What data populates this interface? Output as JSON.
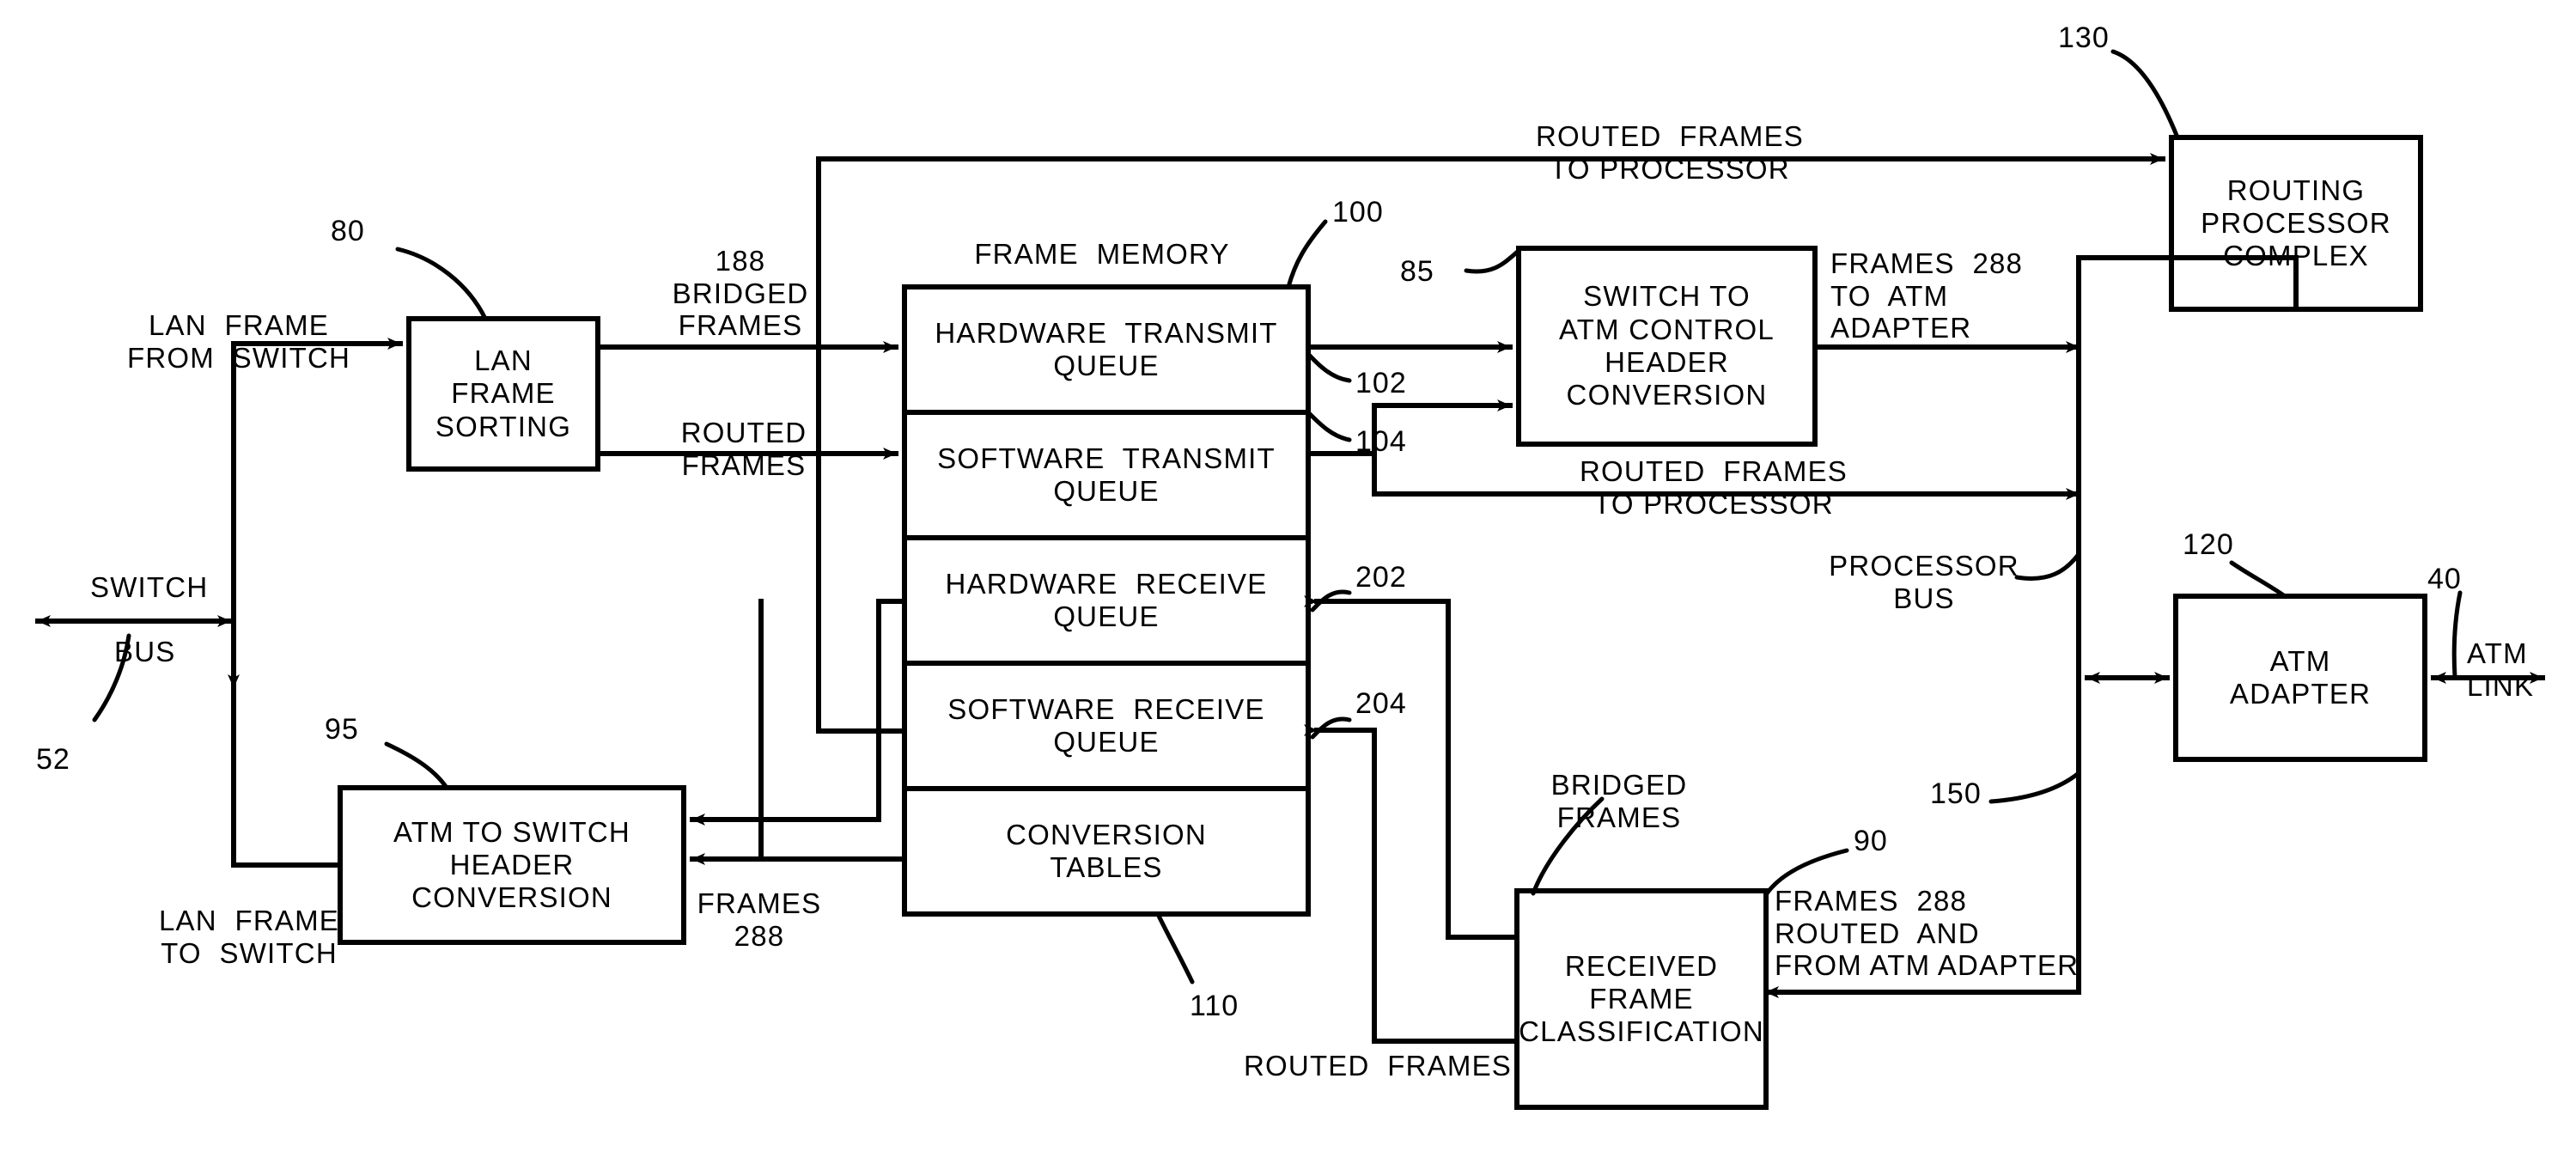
{
  "figure": {
    "title": "ATM / LAN frame switching block diagram",
    "type": "patent-block-diagram"
  },
  "boxes": {
    "lan_frame_sorting": {
      "label": "LAN\nFRAME\nSORTING",
      "ref": "80"
    },
    "atm_to_switch_header_conversion": {
      "label": "ATM TO SWITCH\nHEADER\nCONVERSION",
      "ref": "95"
    },
    "frame_memory": {
      "title": "FRAME  MEMORY",
      "ref": "100",
      "tables_ref": "110"
    },
    "hardware_transmit_queue": {
      "label": "HARDWARE  TRANSMIT\nQUEUE",
      "ref": "102"
    },
    "software_transmit_queue": {
      "label": "SOFTWARE  TRANSMIT\nQUEUE",
      "ref": "104"
    },
    "hardware_receive_queue": {
      "label": "HARDWARE  RECEIVE\nQUEUE",
      "ref": "202"
    },
    "software_receive_queue": {
      "label": "SOFTWARE  RECEIVE\nQUEUE",
      "ref": "204"
    },
    "conversion_tables": {
      "label": "CONVERSION\nTABLES"
    },
    "switch_to_atm_control_header_conversion": {
      "label": "SWITCH TO\nATM CONTROL\nHEADER\nCONVERSION",
      "ref": "85"
    },
    "routing_processor_complex": {
      "label": "ROUTING\nPROCESSOR\nCOMPLEX",
      "ref": "130"
    },
    "atm_adapter": {
      "label": "ATM\nADAPTER",
      "ref": "120"
    },
    "received_frame_classification": {
      "label": "RECEIVED\nFRAME\nCLASSIFICATION",
      "ref": "90"
    }
  },
  "labels": {
    "lan_frame_from_switch": "LAN  FRAME\nFROM  SWITCH",
    "lan_frame_to_switch": "LAN  FRAME\nTO  SWITCH",
    "switch_bus": "SWITCH",
    "switch_bus2": "BUS",
    "switch_bus_ref": "52",
    "bridged_frames_188": "188\nBRIDGED\nFRAMES",
    "routed_frames_left": "ROUTED\nFRAMES",
    "routed_frames_to_processor_top": "ROUTED  FRAMES\nTO PROCESSOR",
    "routed_frames_to_processor_mid": "ROUTED  FRAMES\nTO PROCESSOR",
    "frames_288_to_atm_adapter": "FRAMES  288\nTO  ATM\nADAPTER",
    "processor_bus": "PROCESSOR\nBUS",
    "processor_bus_ref": "150",
    "atm_link": "ATM\nLINK",
    "atm_link_ref": "40",
    "frames_288_left": "FRAMES\n288",
    "bridged_frames_bottom": "BRIDGED\nFRAMES",
    "routed_frames_bottom": "ROUTED  FRAMES",
    "frames_288_routed_and_from_atm_adapter": "FRAMES  288\nROUTED  AND\nFROM ATM ADAPTER"
  },
  "refs": {
    "r40": "40",
    "r52": "52",
    "r80": "80",
    "r85": "85",
    "r90": "90",
    "r95": "95",
    "r100": "100",
    "r102": "102",
    "r104": "104",
    "r110": "110",
    "r120": "120",
    "r130": "130",
    "r150": "150",
    "r202": "202",
    "r204": "204",
    "r188": "188",
    "r288": "288"
  },
  "colors": {
    "stroke": "#000000",
    "background": "#ffffff"
  }
}
